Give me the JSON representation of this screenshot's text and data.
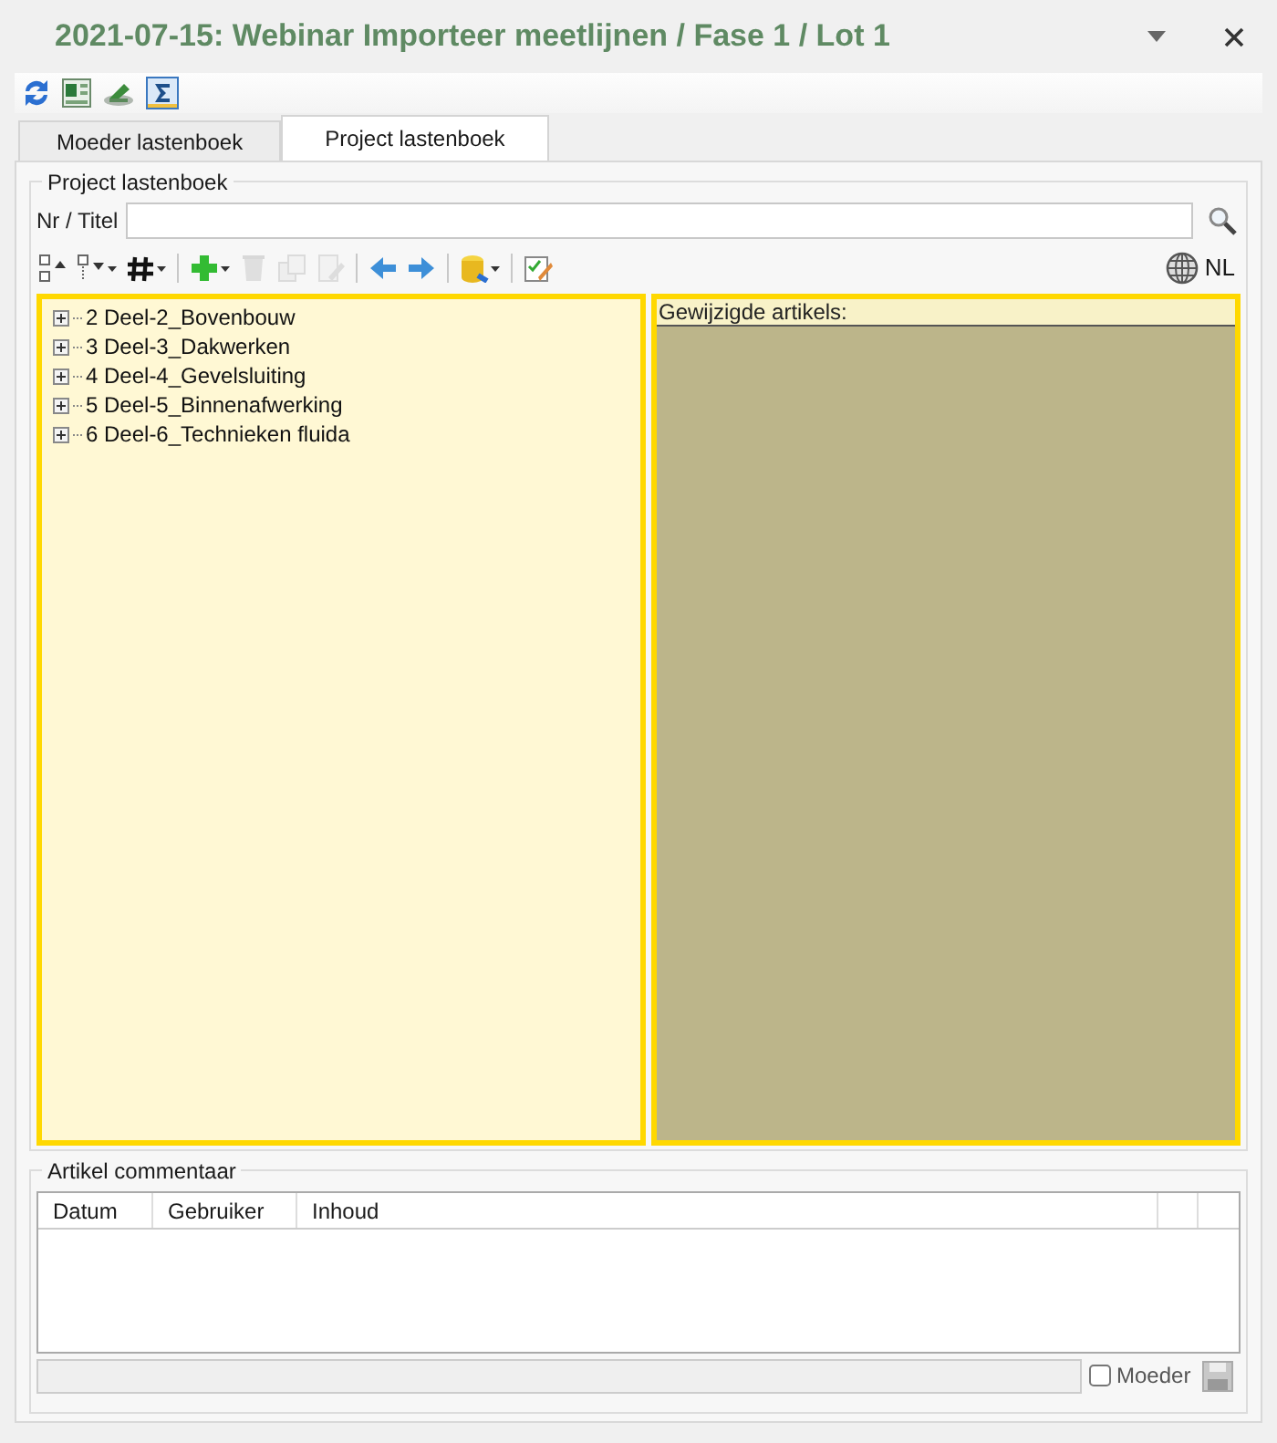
{
  "window": {
    "title": "2021-07-15: Webinar Importeer meetlijnen / Fase 1 / Lot 1"
  },
  "tabs": [
    {
      "label": "Moeder lastenboek",
      "selected": false
    },
    {
      "label": "Project lastenboek",
      "selected": true
    }
  ],
  "project_group": {
    "title": "Project lastenboek",
    "search": {
      "label": "Nr / Titel"
    },
    "tools": [
      {
        "kind": "expand",
        "disabled": false,
        "dropdown": false
      },
      {
        "kind": "collapse",
        "disabled": false,
        "dropdown": true
      },
      {
        "kind": "number",
        "disabled": false,
        "dropdown": true
      },
      {
        "kind": "add",
        "disabled": false,
        "dropdown": true
      },
      {
        "kind": "delete",
        "disabled": true,
        "dropdown": false
      },
      {
        "kind": "copy",
        "disabled": true,
        "dropdown": false
      },
      {
        "kind": "edit",
        "disabled": true,
        "dropdown": false
      },
      {
        "kind": "back",
        "disabled": false,
        "dropdown": false
      },
      {
        "kind": "forward",
        "disabled": false,
        "dropdown": false
      },
      {
        "kind": "database",
        "disabled": false,
        "dropdown": true
      },
      {
        "kind": "checklist",
        "disabled": false,
        "dropdown": false
      }
    ],
    "language": "NL",
    "tree": [
      {
        "label": "2 Deel-2_Bovenbouw",
        "expanded": false
      },
      {
        "label": "3 Deel-3_Dakwerken",
        "expanded": false
      },
      {
        "label": "4 Deel-4_Gevelsluiting",
        "expanded": false
      },
      {
        "label": "5 Deel-5_Binnenafwerking",
        "expanded": false
      },
      {
        "label": "6 Deel-6_Technieken fluida",
        "expanded": false
      }
    ],
    "changed_articles": {
      "title": "Gewijzigde artikels:"
    }
  },
  "comment_group": {
    "title": "Artikel commentaar",
    "columns": [
      "Datum",
      "Gebruiker",
      "Inhoud"
    ],
    "moeder": {
      "label": "Moeder",
      "checked": false
    }
  }
}
